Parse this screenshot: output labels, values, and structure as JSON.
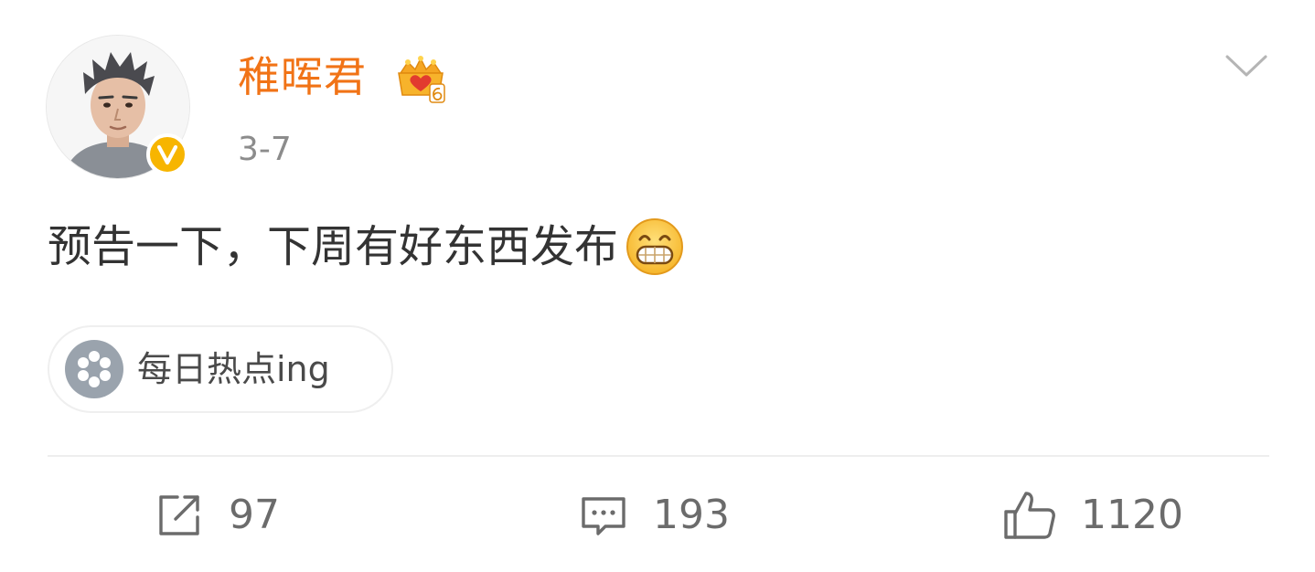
{
  "post": {
    "author": {
      "name": "稚晖君"
    },
    "time": "3-7",
    "text": "预告一下，下周有好东西发布",
    "topic": {
      "label": "每日热点ing"
    }
  },
  "actions": {
    "repost_count": "97",
    "comment_count": "193",
    "like_count": "1120"
  },
  "icons": {
    "avatar": "avatar-photo",
    "verified": "verified-v-badge",
    "vip": "vip-crown-icon",
    "menu": "chevron-down-icon",
    "emoji": "grin-emoji",
    "topic": "topic-icon",
    "repost": "repost-icon",
    "comment": "comment-icon",
    "like": "thumbs-up-icon"
  },
  "colors": {
    "author_name": "#f17316",
    "verified_badge": "#f7b500",
    "text": "#333333",
    "muted": "#8c8c8c",
    "icon_gray": "#6b6b6b",
    "topic_icon_bg": "#9aa3ad"
  }
}
